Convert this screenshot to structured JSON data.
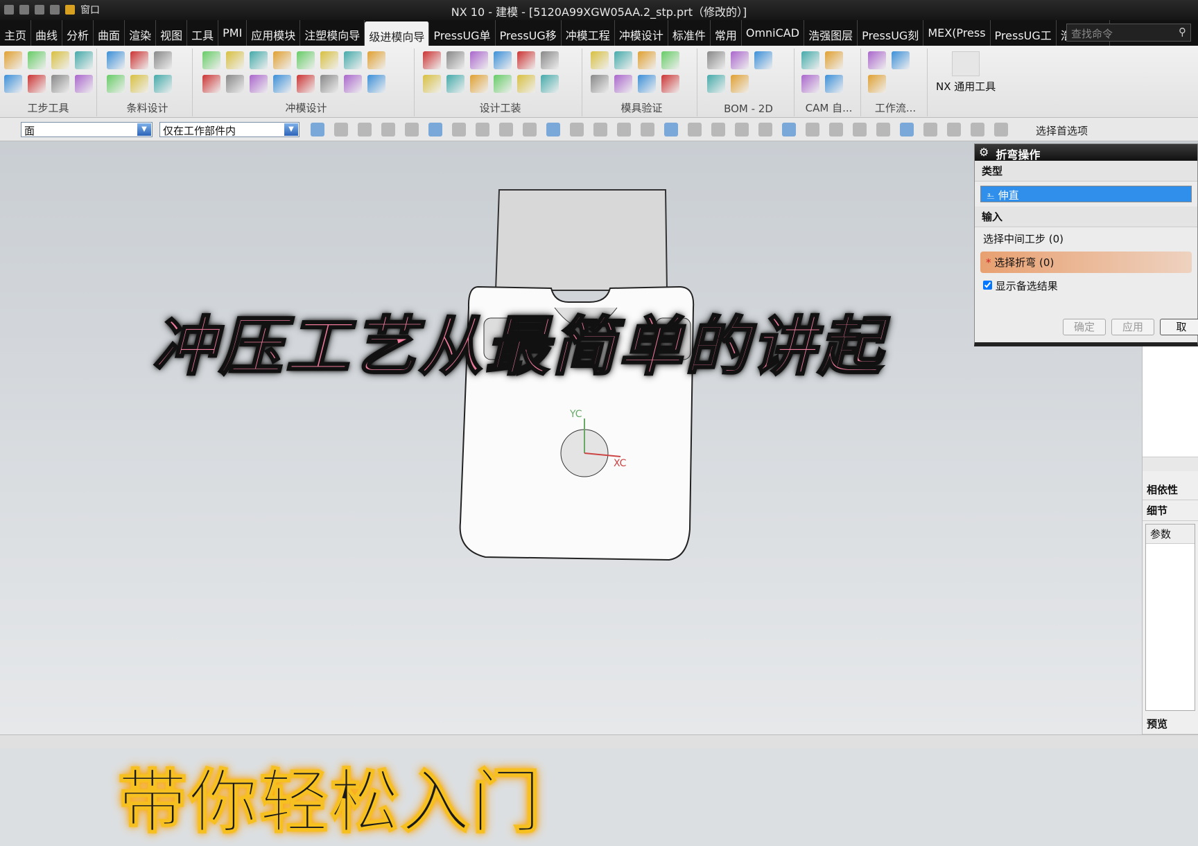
{
  "titlebar": {
    "title": "NX 10 - 建模 - [5120A99XGW05AA.2_stp.prt（修改的）]",
    "window_menu": "窗口"
  },
  "tabs": [
    "主页",
    "曲线",
    "分析",
    "曲面",
    "渲染",
    "视图",
    "工具",
    "PMI",
    "应用模块",
    "注塑模向导",
    "级进模向导",
    "PressUG单",
    "PressUG移",
    "冲模工程",
    "冲模设计",
    "标准件",
    "常用",
    "OmniCAD",
    "浩强图层",
    "PressUG刻",
    "MEX(Press",
    "PressUG工",
    "浩强工具"
  ],
  "active_tab": "级进模向导",
  "search": {
    "placeholder": "查找命令"
  },
  "ribbon_groups": [
    "工步工具",
    "条料设计",
    "冲模设计",
    "设计工装",
    "模具验证",
    "BOM - 2D",
    "CAM 自...",
    "工作流..."
  ],
  "nx_tool": "NX 通用工具",
  "selection": {
    "filter": "面",
    "scope": "仅在工作部件内",
    "prefs": "选择首选项"
  },
  "overlay": {
    "headline": "冲压工艺从最简单的讲起",
    "subline": "带你轻松入门"
  },
  "axes": {
    "y": "YC",
    "x": "XC"
  },
  "dialog": {
    "title": "折弯操作",
    "type_section": "类型",
    "type_value": "伸直",
    "input_section": "输入",
    "select_step": "选择中间工步 (0)",
    "select_bend": "选择折弯 (0)",
    "show_alt": "显示备选结果",
    "show_alt_checked": true,
    "ok": "确定",
    "apply": "应用",
    "cancel": "取"
  },
  "right_panel": {
    "dependency": "相依性",
    "details": "细节",
    "params": "参数",
    "preview": "预览"
  }
}
